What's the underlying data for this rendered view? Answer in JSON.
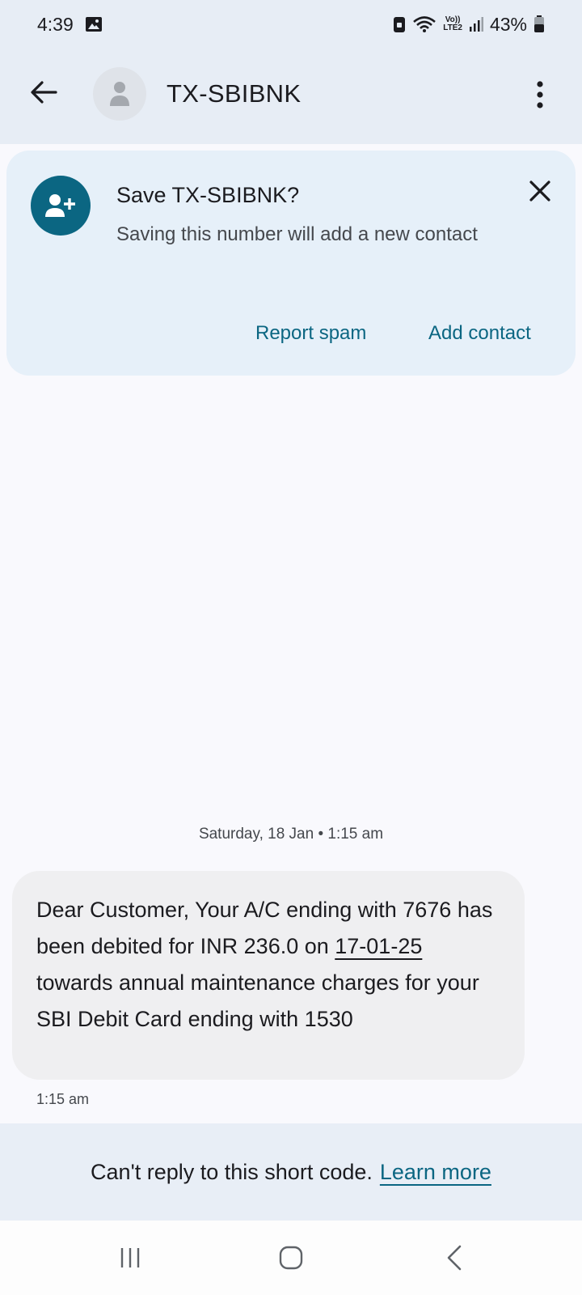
{
  "status_bar": {
    "time": "4:39",
    "battery_percent": "43%",
    "icons": [
      "image-icon",
      "lock-icon",
      "wifi-icon",
      "volte-icon",
      "signal-icon",
      "battery-icon"
    ],
    "volte_top": "Vo))",
    "volte_bottom": "LTE2"
  },
  "app_bar": {
    "title": "TX-SBIBNK"
  },
  "save_card": {
    "title": "Save TX-SBIBNK?",
    "text": "Saving this number will add a new contact",
    "report_spam_label": "Report spam",
    "add_contact_label": "Add contact"
  },
  "conversation": {
    "date_separator": "Saturday, 18 Jan • 1:15 am",
    "message": {
      "text_part1": "Dear Customer, Your A/C ending with 7676 has been debited for INR 236.0 on ",
      "date_link": "17-01-25",
      "text_part2": " towards annual maintenance charges for your SBI Debit Card ending with 1530",
      "time": "1:15 am"
    }
  },
  "reply_bar": {
    "text": "Can't reply to this short code.",
    "learn_more": "Learn more"
  },
  "colors": {
    "accent": "#0b6682",
    "header_bg": "#e7edf5",
    "card_bg": "#e6f0f9",
    "bubble_bg": "#efeff1"
  }
}
